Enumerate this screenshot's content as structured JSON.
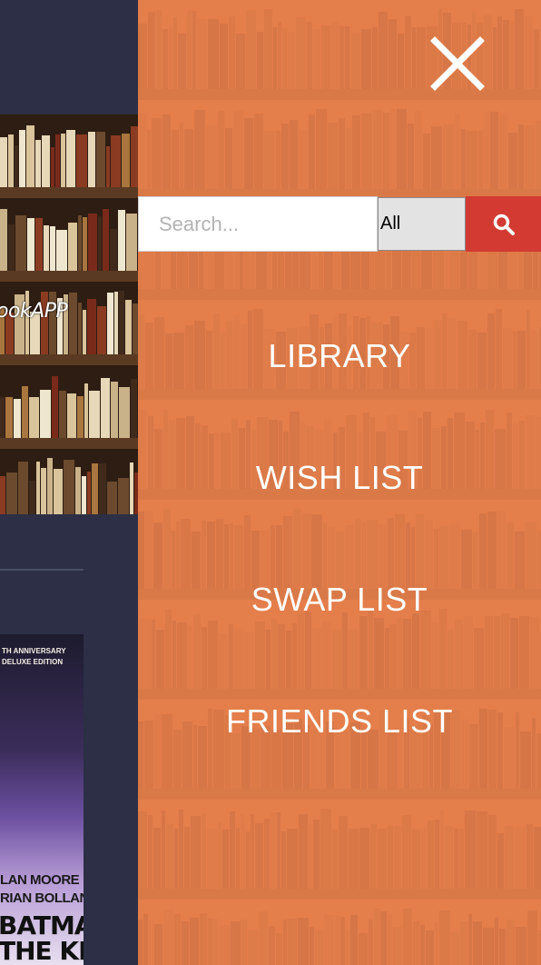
{
  "app": {
    "brand_text": "ookAPP"
  },
  "book_cover": {
    "line1": "TH ANNIVERSARY",
    "line2": "DELUXE EDITION",
    "author1": "LAN MOORE",
    "author2": "RIAN BOLLAND",
    "title1": "BATMAN",
    "title2": "THE KILLIN"
  },
  "nav": {
    "close_icon": "close-x-icon",
    "search": {
      "placeholder": "Search...",
      "value": "",
      "filter_selected": "All",
      "button_icon": "search-icon"
    },
    "links": [
      {
        "label": "LIBRARY"
      },
      {
        "label": "WISH LIST"
      },
      {
        "label": "SWAP LIST"
      },
      {
        "label": "FRIENDS LIST"
      }
    ]
  },
  "colors": {
    "panel_orange": "#e07c4a",
    "search_button_red": "#d23a32",
    "background_navy": "#2c2f45"
  }
}
